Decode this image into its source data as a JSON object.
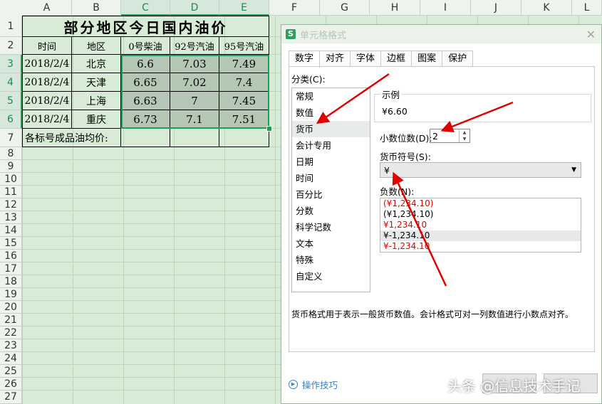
{
  "columns": [
    "A",
    "B",
    "C",
    "D",
    "E",
    "F",
    "G",
    "H",
    "I",
    "J",
    "K",
    "L"
  ],
  "rows": [
    "1",
    "2",
    "3",
    "4",
    "5",
    "6",
    "7",
    "8",
    "9",
    "10",
    "11",
    "12",
    "13",
    "14",
    "15",
    "16",
    "17",
    "18",
    "19",
    "20",
    "21",
    "22",
    "23",
    "24",
    "25",
    "26",
    "27"
  ],
  "table": {
    "title": "部分地区今日国内油价",
    "headers": [
      "时间",
      "地区",
      "0号柴油",
      "92号汽油",
      "95号汽油"
    ],
    "data": [
      [
        "2018/2/4",
        "北京",
        "6.6",
        "7.03",
        "7.49"
      ],
      [
        "2018/2/4",
        "天津",
        "6.65",
        "7.02",
        "7.4"
      ],
      [
        "2018/2/4",
        "上海",
        "6.63",
        "7",
        "7.45"
      ],
      [
        "2018/2/4",
        "重庆",
        "6.73",
        "7.1",
        "7.51"
      ]
    ],
    "footer": "各标号成品油均价:"
  },
  "dialog": {
    "title": "单元格格式",
    "app_icon": "S",
    "close_icon": "✕",
    "tabs": [
      "数字",
      "对齐",
      "字体",
      "边框",
      "图案",
      "保护"
    ],
    "category_label": "分类(C):",
    "categories": [
      "常规",
      "数值",
      "货币",
      "会计专用",
      "日期",
      "时间",
      "百分比",
      "分数",
      "科学记数",
      "文本",
      "特殊",
      "自定义"
    ],
    "selected_category": "货币",
    "sample_label": "示例",
    "sample_value": "¥6.60",
    "decimal_label": "小数位数(D):",
    "decimal_value": "2",
    "symbol_label": "货币符号(S):",
    "symbol_value": "¥",
    "negative_label": "负数(N):",
    "negative_options": [
      "(¥1,234.10)",
      "(¥1,234.10)",
      "¥1,234.10",
      "¥-1,234.10",
      "¥-1,234.10"
    ],
    "description": "货币格式用于表示一般货币数值。会计格式可对一列数值进行小数点对齐。",
    "tips_label": "操作技巧"
  },
  "watermark": "头条 @信息技术手记",
  "colors": {
    "selection": "#1f9e57",
    "arrow": "#e00000",
    "sheet_bg": "#d7ebd6",
    "negative_red": "#e00000",
    "link": "#3a7fc5"
  }
}
